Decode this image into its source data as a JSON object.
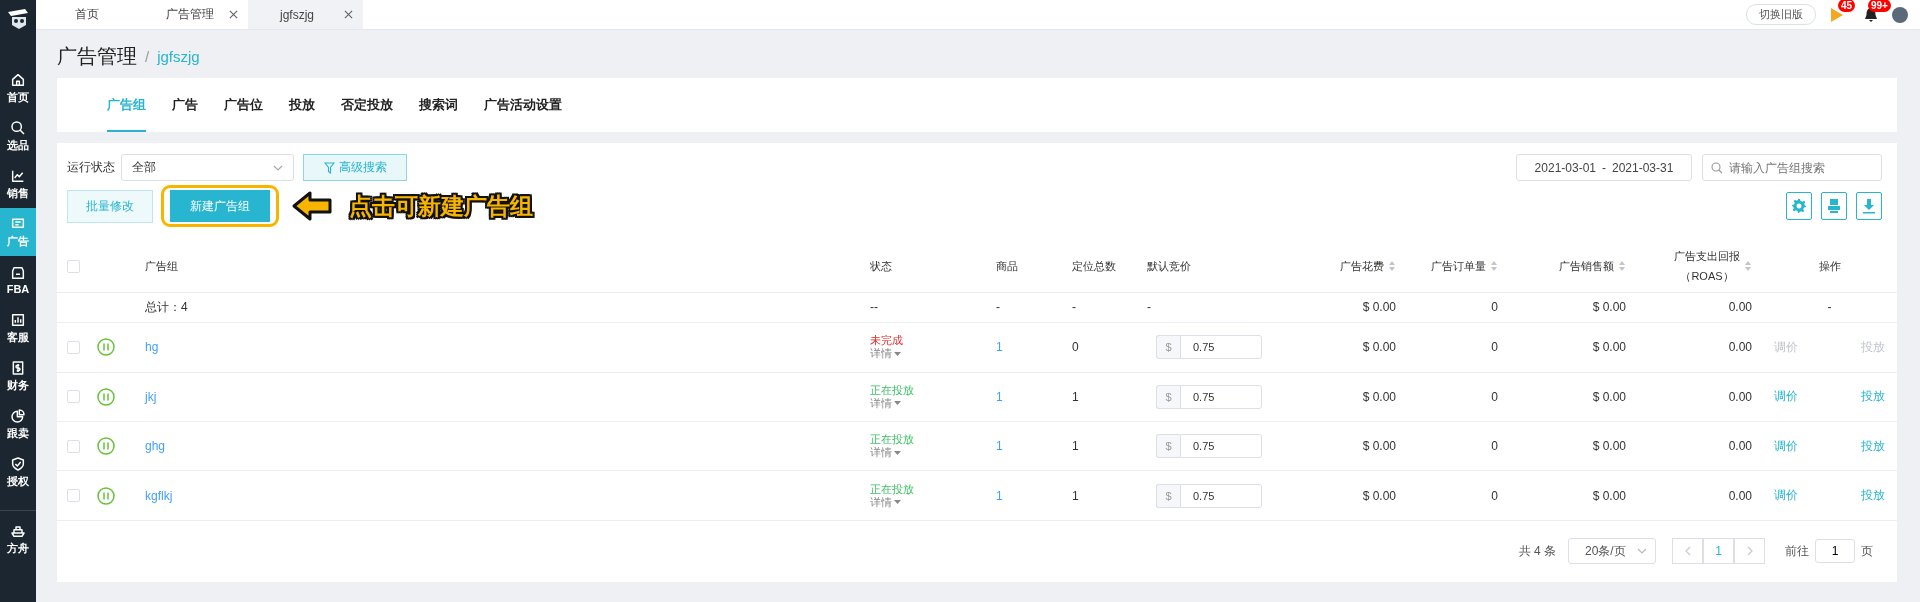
{
  "sidebar": {
    "items": [
      {
        "label": "首页",
        "selected": false
      },
      {
        "label": "选品",
        "selected": false
      },
      {
        "label": "销售",
        "selected": false
      },
      {
        "label": "广告",
        "selected": true
      },
      {
        "label": "FBA",
        "selected": false
      },
      {
        "label": "客服",
        "selected": false
      },
      {
        "label": "财务",
        "selected": false
      },
      {
        "label": "跟卖",
        "selected": false
      },
      {
        "label": "授权",
        "selected": false
      }
    ],
    "bottom_items": [
      {
        "label": "方舟",
        "selected": false
      }
    ]
  },
  "top_tabs": [
    {
      "label": "首页",
      "closable": false,
      "selected": false
    },
    {
      "label": "广告管理",
      "closable": true,
      "selected": false
    },
    {
      "label": "jgfszjg",
      "closable": true,
      "selected": true
    }
  ],
  "header": {
    "switch_button": "切换旧版",
    "flag_badge": "45",
    "bell_badge": "99+"
  },
  "breadcrumb": {
    "title": "广告管理",
    "separator": "/",
    "current": "jgfszjg"
  },
  "tabs": [
    {
      "label": "广告组",
      "selected": true
    },
    {
      "label": "广告",
      "selected": false
    },
    {
      "label": "广告位",
      "selected": false
    },
    {
      "label": "投放",
      "selected": false
    },
    {
      "label": "否定投放",
      "selected": false
    },
    {
      "label": "搜索词",
      "selected": false
    },
    {
      "label": "广告活动设置",
      "selected": false
    }
  ],
  "filters": {
    "status_label": "运行状态",
    "status_value": "全部",
    "advanced_search": "高级搜索",
    "date_start": "2021-03-01",
    "date_separator": "-",
    "date_end": "2021-03-31",
    "search_placeholder": "请输入广告组搜索"
  },
  "buttons": {
    "batch_edit": "批量修改",
    "new_group": "新建广告组"
  },
  "annotation": {
    "text": "点击可新建广告组"
  },
  "table": {
    "header_checked": false,
    "columns": [
      {
        "label": "广告组",
        "sortable": false
      },
      {
        "label": "状态",
        "sortable": false
      },
      {
        "label": "商品",
        "sortable": false
      },
      {
        "label": "定位总数",
        "sortable": false
      },
      {
        "label": "默认竞价",
        "sortable": false
      },
      {
        "label": "广告花费",
        "sortable": true
      },
      {
        "label": "广告订单量",
        "sortable": true
      },
      {
        "label": "广告销售额",
        "sortable": true
      },
      {
        "label": "广告支出回报",
        "label_line_2": "（ROAS）",
        "sortable": true
      },
      {
        "label": "操作",
        "sortable": false
      }
    ],
    "total": {
      "label": "总计：4",
      "status": "--",
      "products": "-",
      "targets": "-",
      "bid": "-",
      "spend": "$ 0.00",
      "orders": "0",
      "sales": "$ 0.00",
      "roas": "0.00",
      "actions": "-"
    },
    "rows": [
      {
        "name": "hg",
        "checked": false,
        "status": {
          "text": "未完成",
          "kind": "incomplete"
        },
        "detail": "详情",
        "products": "1",
        "targets": "0",
        "bid_currency": "$",
        "bid": "0.75",
        "spend": "$ 0.00",
        "orders": "0",
        "sales": "$ 0.00",
        "roas": "0.00",
        "actions": [
          {
            "label": "调价",
            "disabled": true
          },
          {
            "label": "投放",
            "disabled": true
          }
        ]
      },
      {
        "name": "jkj",
        "checked": false,
        "status": {
          "text": "正在投放",
          "kind": "running"
        },
        "detail": "详情",
        "products": "1",
        "targets": "1",
        "bid_currency": "$",
        "bid": "0.75",
        "spend": "$ 0.00",
        "orders": "0",
        "sales": "$ 0.00",
        "roas": "0.00",
        "actions": [
          {
            "label": "调价",
            "disabled": false
          },
          {
            "label": "投放",
            "disabled": false
          }
        ]
      },
      {
        "name": "ghg",
        "checked": false,
        "status": {
          "text": "正在投放",
          "kind": "running"
        },
        "detail": "详情",
        "products": "1",
        "targets": "1",
        "bid_currency": "$",
        "bid": "0.75",
        "spend": "$ 0.00",
        "orders": "0",
        "sales": "$ 0.00",
        "roas": "0.00",
        "actions": [
          {
            "label": "调价",
            "disabled": false
          },
          {
            "label": "投放",
            "disabled": false
          }
        ]
      },
      {
        "name": "kgflkj",
        "checked": false,
        "status": {
          "text": "正在投放",
          "kind": "running"
        },
        "detail": "详情",
        "products": "1",
        "targets": "1",
        "bid_currency": "$",
        "bid": "0.75",
        "spend": "$ 0.00",
        "orders": "0",
        "sales": "$ 0.00",
        "roas": "0.00",
        "actions": [
          {
            "label": "调价",
            "disabled": false
          },
          {
            "label": "投放",
            "disabled": false
          }
        ]
      }
    ]
  },
  "pagination": {
    "total": "共 4 条",
    "page_size": "20条/页",
    "current_page": "1",
    "goto_label": "前往",
    "goto_value": "1",
    "page_suffix": "页"
  }
}
